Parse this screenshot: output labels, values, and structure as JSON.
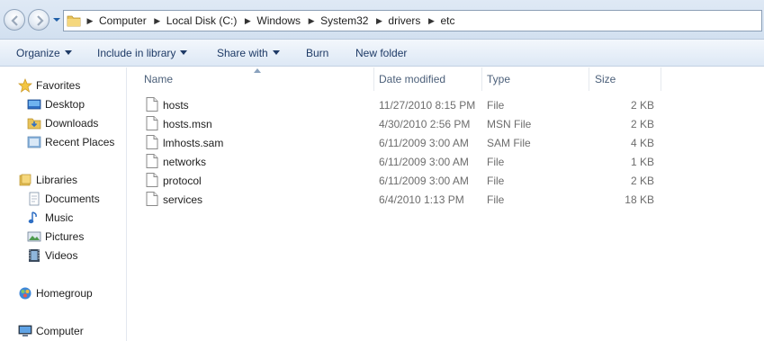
{
  "breadcrumb": [
    "Computer",
    "Local Disk (C:)",
    "Windows",
    "System32",
    "drivers",
    "etc"
  ],
  "toolbar": {
    "organize": "Organize",
    "include_in_library": "Include in library",
    "share_with": "Share with",
    "burn": "Burn",
    "new_folder": "New folder"
  },
  "nav": {
    "favorites": "Favorites",
    "desktop": "Desktop",
    "downloads": "Downloads",
    "recent_places": "Recent Places",
    "libraries": "Libraries",
    "documents": "Documents",
    "music": "Music",
    "pictures": "Pictures",
    "videos": "Videos",
    "homegroup": "Homegroup",
    "computer": "Computer"
  },
  "columns": {
    "name": "Name",
    "date_modified": "Date modified",
    "type": "Type",
    "size": "Size"
  },
  "sort": {
    "column": "name",
    "direction": "ascending"
  },
  "files": [
    {
      "name": "hosts",
      "date": "11/27/2010 8:15 PM",
      "type": "File",
      "size": "2 KB"
    },
    {
      "name": "hosts.msn",
      "date": "4/30/2010 2:56 PM",
      "type": "MSN File",
      "size": "2 KB"
    },
    {
      "name": "lmhosts.sam",
      "date": "6/11/2009 3:00 AM",
      "type": "SAM File",
      "size": "4 KB"
    },
    {
      "name": "networks",
      "date": "6/11/2009 3:00 AM",
      "type": "File",
      "size": "1 KB"
    },
    {
      "name": "protocol",
      "date": "6/11/2009 3:00 AM",
      "type": "File",
      "size": "2 KB"
    },
    {
      "name": "services",
      "date": "6/4/2010 1:13 PM",
      "type": "File",
      "size": "18 KB"
    }
  ],
  "colors": {
    "toolbar_text": "#1e3a66",
    "header_text": "#4c607a",
    "detail_text": "#6d6d6d",
    "chrome_bg": "#dfe9f5"
  }
}
